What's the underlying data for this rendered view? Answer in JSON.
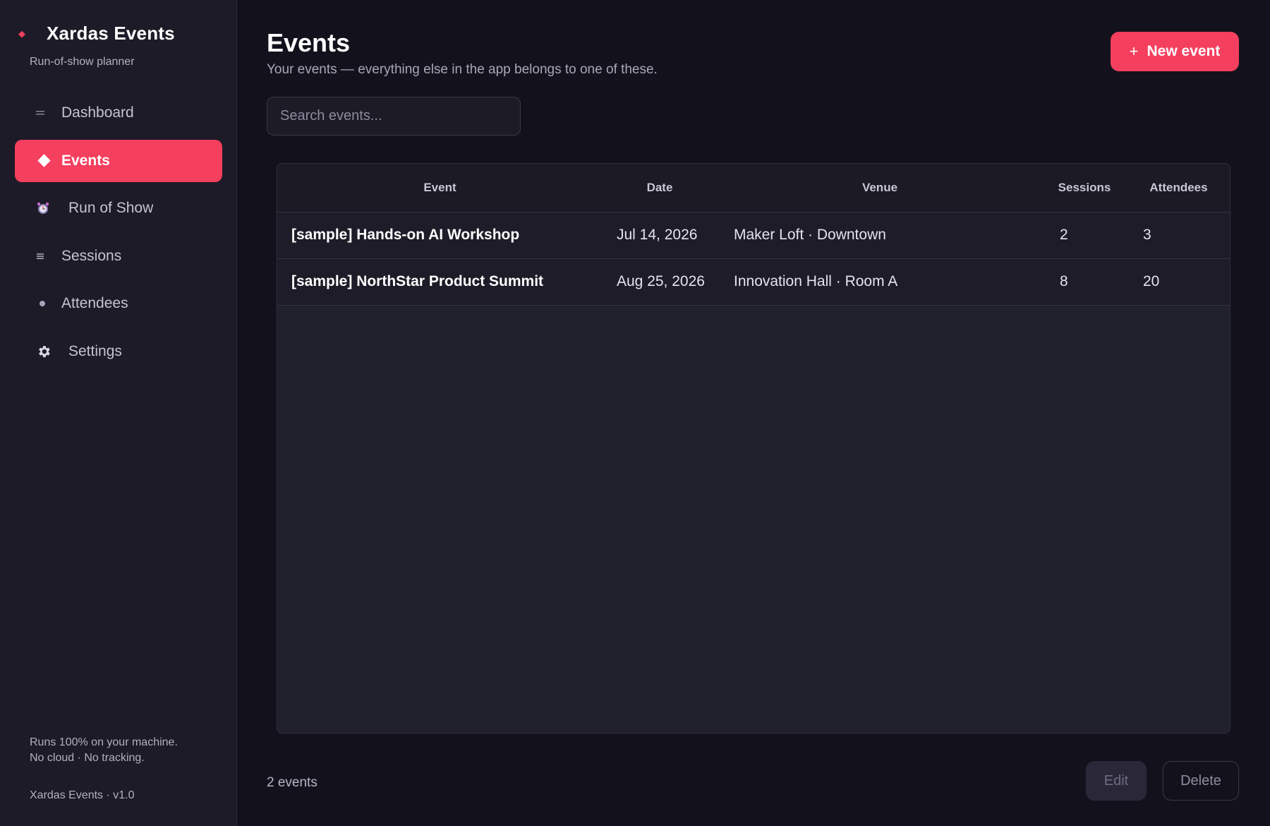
{
  "sidebar": {
    "brand_icon": "diamond-icon",
    "brand_name": "Xardas Events",
    "brand_subtitle": "Run-of-show planner",
    "items": [
      {
        "label": "Dashboard",
        "icon": "dashboard-icon",
        "active": false
      },
      {
        "label": "Events",
        "icon": "diamond-icon",
        "active": true
      },
      {
        "label": "Run of Show",
        "icon": "alarm-clock-icon",
        "active": false
      },
      {
        "label": "Sessions",
        "icon": "list-icon",
        "active": false
      },
      {
        "label": "Attendees",
        "icon": "dot-icon",
        "active": false
      },
      {
        "label": "Settings",
        "icon": "gear-icon",
        "active": false
      }
    ],
    "footer_line1": "Runs 100% on your machine.",
    "footer_line2": "No cloud · No tracking.",
    "version": "Xardas Events · v1.0"
  },
  "header": {
    "title": "Events",
    "subtitle": "Your events — everything else in the app belongs to one of these.",
    "new_button_label": "New event",
    "new_button_icon": "plus-icon"
  },
  "search": {
    "placeholder": "Search events..."
  },
  "table": {
    "columns": [
      "Event",
      "Date",
      "Venue",
      "Sessions",
      "Attendees"
    ],
    "rows": [
      {
        "event": "[sample] Hands-on AI Workshop",
        "date": "Jul 14, 2026",
        "venue": "Maker Loft · Downtown",
        "sessions": "2",
        "attendees": "3"
      },
      {
        "event": "[sample] NorthStar Product Summit",
        "date": "Aug 25, 2026",
        "venue": "Innovation Hall · Room A",
        "sessions": "8",
        "attendees": "20"
      }
    ]
  },
  "footer": {
    "count_label": "2 events",
    "edit_label": "Edit",
    "delete_label": "Delete"
  },
  "colors": {
    "accent": "#f43f5e",
    "background": "#13121c",
    "sidebar": "#1c1b27"
  }
}
